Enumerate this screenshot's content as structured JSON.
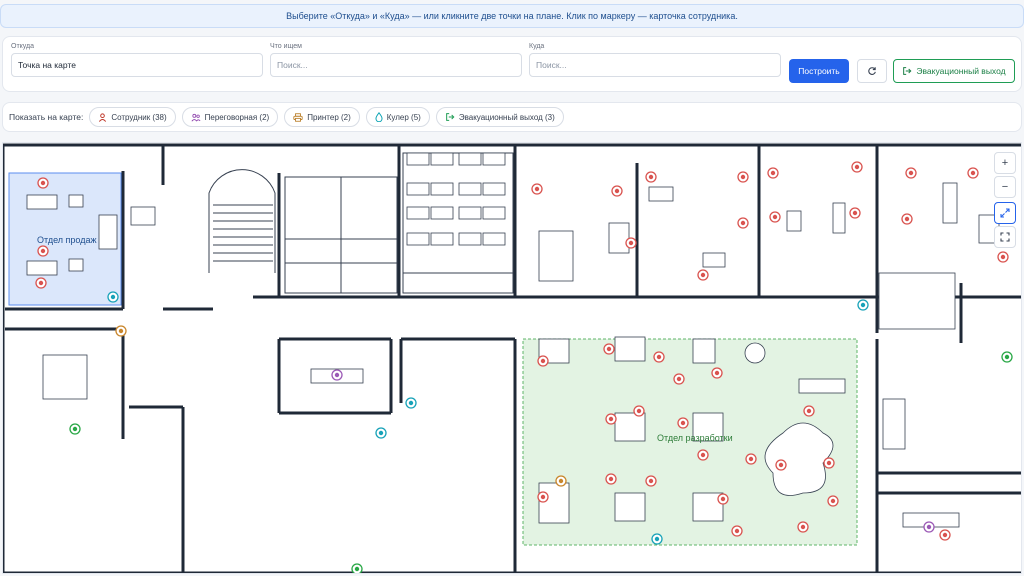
{
  "banner": {
    "text": "Выберите «Откуда» и «Куда» — или кликните две точки на плане. Клик по маркеру — карточка сотрудника."
  },
  "controls": {
    "from_label": "Откуда",
    "from_value": "Точка на карте",
    "what_label": "Что ищем",
    "what_placeholder": "Поиск...",
    "to_label": "Куда",
    "to_placeholder": "Поиск...",
    "build_label": "Построить",
    "exit_label": "Эвакуационный выход"
  },
  "filters": {
    "label": "Показать на карте:",
    "chips": [
      {
        "label": "Сотрудник (38)",
        "icon": "person-icon",
        "color": "#c0392b"
      },
      {
        "label": "Переговорная (2)",
        "icon": "people-icon",
        "color": "#8e44ad"
      },
      {
        "label": "Принтер (2)",
        "icon": "printer-icon",
        "color": "#b7791f"
      },
      {
        "label": "Кулер (5)",
        "icon": "drop-icon",
        "color": "#0ea5b5"
      },
      {
        "label": "Эвакуационный выход (3)",
        "icon": "exit-icon",
        "color": "#1f9d55"
      }
    ]
  },
  "map": {
    "zones": [
      {
        "label": "Отдел продаж",
        "fill": "#dbe7fb",
        "stroke": "#5b8def"
      },
      {
        "label": "Отдел разработки",
        "fill": "#e3f3e3",
        "stroke": "#5fb56a"
      }
    ],
    "colors": {
      "employee": "#d9534f",
      "meeting": "#9b59b6",
      "printer": "#c9862c",
      "cooler": "#17a2b8",
      "exit": "#28a745"
    }
  },
  "zoom": {
    "plus": "+",
    "minus": "−"
  }
}
